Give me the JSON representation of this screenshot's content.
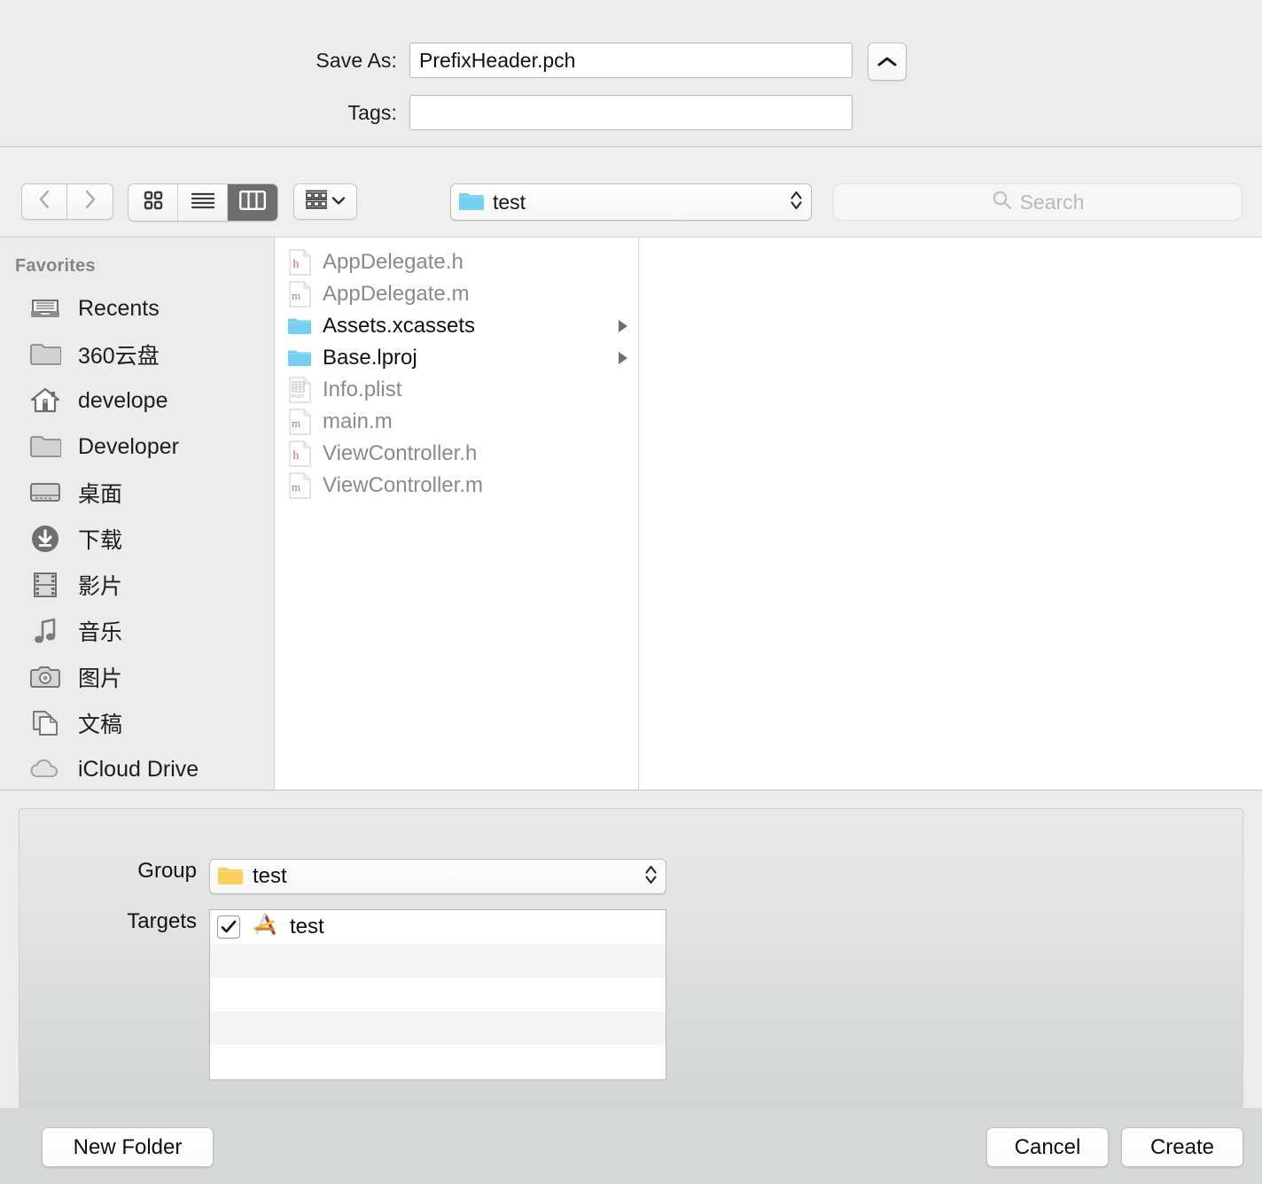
{
  "header": {
    "save_as_label": "Save As:",
    "save_as_value": "PrefixHeader.pch",
    "tags_label": "Tags:",
    "tags_value": "",
    "disclosure_icon": "chevron-up-icon"
  },
  "toolbar": {
    "back_icon": "chevron-left-icon",
    "forward_icon": "chevron-right-icon",
    "view_modes": [
      {
        "name": "icon-view",
        "icon": "grid-icon",
        "active": false
      },
      {
        "name": "list-view",
        "icon": "list-icon",
        "active": false
      },
      {
        "name": "column-view",
        "icon": "columns-icon",
        "active": true
      }
    ],
    "arrange_icon": "arrange-grid-icon",
    "arrange_chevron": "chevron-down-icon",
    "path_popup": {
      "label": "test",
      "icon": "blue-folder-icon",
      "stepper": "up-down-arrows-icon"
    },
    "search": {
      "placeholder": "Search",
      "value": "",
      "icon": "search-icon"
    }
  },
  "sidebar": {
    "section_title": "Favorites",
    "items": [
      {
        "label": "Recents",
        "icon": "recents-icon"
      },
      {
        "label": "360云盘",
        "icon": "folder-icon"
      },
      {
        "label": "develope",
        "icon": "home-icon"
      },
      {
        "label": "Developer",
        "icon": "folder-icon"
      },
      {
        "label": "桌面",
        "icon": "desktop-icon"
      },
      {
        "label": "下载",
        "icon": "downloads-icon"
      },
      {
        "label": "影片",
        "icon": "movies-icon"
      },
      {
        "label": "音乐",
        "icon": "music-icon"
      },
      {
        "label": "图片",
        "icon": "pictures-icon"
      },
      {
        "label": "文稿",
        "icon": "documents-icon"
      },
      {
        "label": "iCloud Drive",
        "icon": "cloud-icon"
      }
    ]
  },
  "file_list": [
    {
      "name": "AppDelegate.h",
      "icon": "h-file-icon",
      "kind": "file",
      "has_children": false
    },
    {
      "name": "AppDelegate.m",
      "icon": "m-file-icon",
      "kind": "file",
      "has_children": false
    },
    {
      "name": "Assets.xcassets",
      "icon": "blue-folder-icon",
      "kind": "folder",
      "has_children": true
    },
    {
      "name": "Base.lproj",
      "icon": "blue-folder-icon",
      "kind": "folder",
      "has_children": true
    },
    {
      "name": "Info.plist",
      "icon": "plist-file-icon",
      "kind": "file",
      "has_children": false
    },
    {
      "name": "main.m",
      "icon": "m-file-icon",
      "kind": "file",
      "has_children": false
    },
    {
      "name": "ViewController.h",
      "icon": "h-file-icon",
      "kind": "file",
      "has_children": false
    },
    {
      "name": "ViewController.m",
      "icon": "m-file-icon",
      "kind": "file",
      "has_children": false
    }
  ],
  "accessory": {
    "group_label": "Group",
    "group_value": "test",
    "group_icon": "yellow-folder-icon",
    "group_stepper": "up-down-arrows-icon",
    "targets_label": "Targets",
    "targets": [
      {
        "name": "test",
        "checked": true,
        "icon": "xcode-app-icon"
      }
    ],
    "empty_row_count": 4
  },
  "footer": {
    "new_folder_label": "New Folder",
    "cancel_label": "Cancel",
    "create_label": "Create"
  },
  "colors": {
    "folder_blue": "#74d0f1",
    "folder_yellow": "#f5c council",
    "window_bg": "#ececec",
    "accent_dark": "#6e6e6e"
  }
}
